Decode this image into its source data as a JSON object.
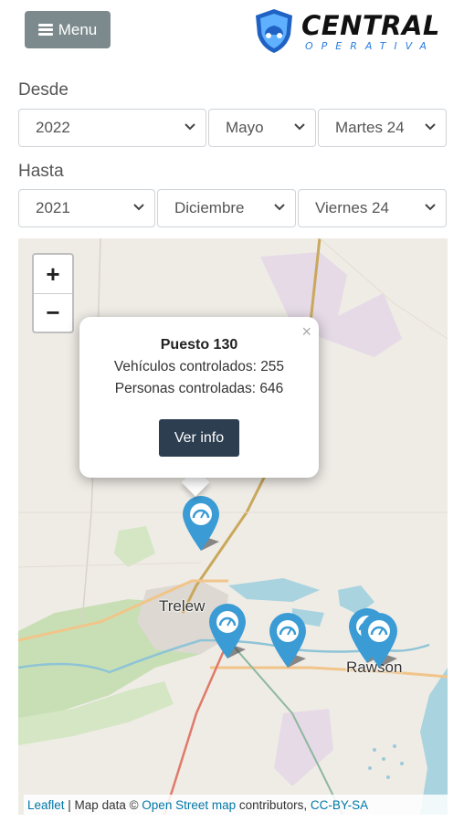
{
  "header": {
    "menu_label": "Menu",
    "logo_title": "CENTRAL",
    "logo_subtitle": "OPERATIVA",
    "brand_color": "#2a7de1"
  },
  "filters": {
    "from_label": "Desde",
    "from": {
      "year": "2022",
      "month": "Mayo",
      "day": "Martes 24"
    },
    "to_label": "Hasta",
    "to": {
      "year": "2021",
      "month": "Diciembre",
      "day": "Viernes 24"
    }
  },
  "map": {
    "zoom_in": "+",
    "zoom_out": "−",
    "places": [
      "Trelew",
      "Rawson"
    ],
    "marker_color": "#3a9bd5",
    "popup": {
      "close": "×",
      "title": "Puesto 130",
      "vehicles": "Vehículos controlados: 255",
      "people": "Personas controladas: 646",
      "button": "Ver info"
    },
    "attribution": {
      "leaflet": "Leaflet",
      "sep": " | Map data © ",
      "osm": "Open Street map",
      "contrib": " contributors, ",
      "license": "CC-BY-SA"
    }
  }
}
